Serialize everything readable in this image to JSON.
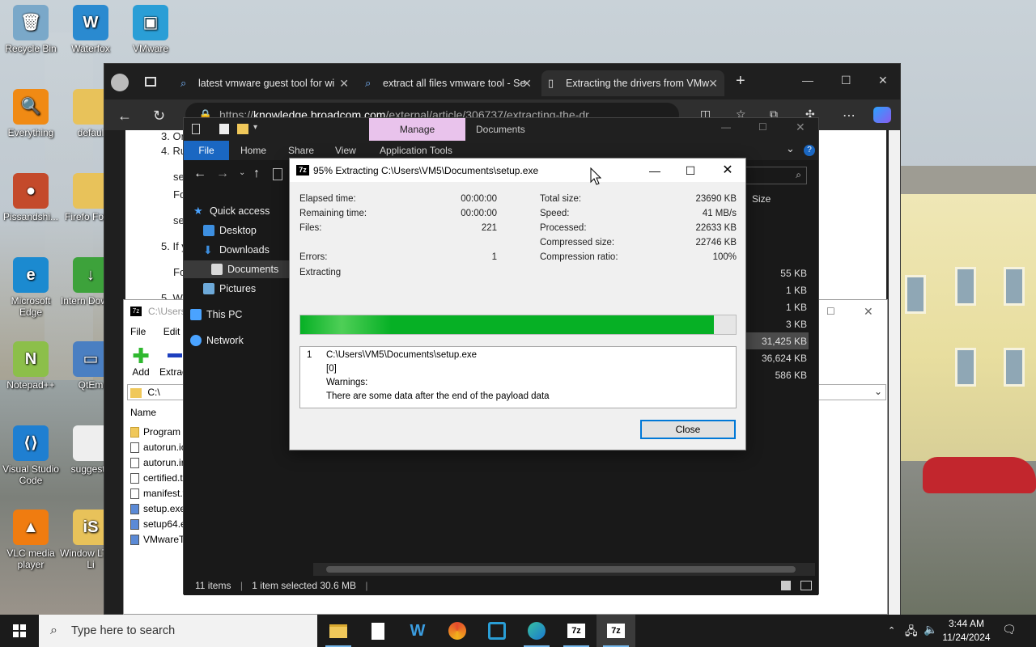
{
  "desktop": {
    "icons": [
      {
        "label": "Recycle Bin",
        "glyph": "🗑",
        "color": "#7aa8c9"
      },
      {
        "label": "Waterfox",
        "glyph": "W",
        "color": "#2a8ad0"
      },
      {
        "label": "VMware",
        "glyph": "▣",
        "color": "#2a9ed6"
      },
      {
        "label": "Everything",
        "glyph": "🔍",
        "color": "#f08a14"
      },
      {
        "label": "defaul",
        "glyph": "",
        "color": "#e8c25a"
      },
      {
        "label": "Pissandshi...",
        "glyph": "●",
        "color": "#c44a2b"
      },
      {
        "label": "Firefo Folde",
        "glyph": "",
        "color": "#e8c25a"
      },
      {
        "label": "Microsoft Edge",
        "glyph": "e",
        "color": "#1b8ad0"
      },
      {
        "label": "Intern Downlo",
        "glyph": "↓",
        "color": "#3da23b"
      },
      {
        "label": "Notepad++",
        "glyph": "N",
        "color": "#8cbf4a"
      },
      {
        "label": "QtEm",
        "glyph": "▭",
        "color": "#4a7fc2"
      },
      {
        "label": "Visual Studio Code",
        "glyph": "⟨⟩",
        "color": "#1f7fd1"
      },
      {
        "label": "suggeste",
        "glyph": "",
        "color": "#eeeeee"
      },
      {
        "label": "VLC media player",
        "glyph": "▲",
        "color": "#f07c10"
      },
      {
        "label": "Window LTSC Li",
        "glyph": "iS",
        "color": "#e8c25a"
      }
    ]
  },
  "browser": {
    "tabs": [
      {
        "label": "latest vmware guest tool for wi",
        "close": "✕"
      },
      {
        "label": "extract all files vmware tool - Se",
        "close": "✕"
      },
      {
        "label": "Extracting the drivers from VMw",
        "close": "✕"
      }
    ],
    "new_tab": "+",
    "url_prefix": "https://",
    "url_host": "knowledge.broadcom.com",
    "url_path": "/external/article/306737/extracting-the-dr...",
    "page_lines": [
      "3. Or",
      "4. Ru",
      "se",
      "Fo",
      "se",
      "5. If y",
      "Fo",
      "5. W"
    ]
  },
  "explorer": {
    "ribbon_tabs": [
      "File",
      "Home",
      "Share",
      "View",
      "Application Tools"
    ],
    "context_tab": "Manage",
    "title_tab": "Documents",
    "sidebar": [
      "Quick access",
      "Desktop",
      "Downloads",
      "Documents",
      "Pictures",
      "This PC",
      "Network"
    ],
    "size_header": "Size",
    "sizes": [
      "55 KB",
      "1 KB",
      "1 KB",
      "3 KB",
      "31,425 KB",
      "36,624 KB",
      "586 KB"
    ],
    "status_items": "11 items",
    "status_selected": "1 item selected  30.6 MB"
  },
  "sevenzip_fm": {
    "title": "C:\\Users",
    "menu": [
      "File",
      "Edit"
    ],
    "tools": [
      "Add",
      "Extrac"
    ],
    "path": "C:\\",
    "name_header": "Name",
    "files": [
      "Program I",
      "autorun.ic",
      "autorun.ir",
      "certified.t",
      "manifest.t",
      "setup.exe",
      "setup64.e",
      "VMwareTo"
    ]
  },
  "dialog": {
    "title": "95% Extracting C:\\Users\\VM5\\Documents\\setup.exe",
    "elapsed_label": "Elapsed time:",
    "elapsed": "00:00:00",
    "remaining_label": "Remaining time:",
    "remaining": "00:00:00",
    "files_label": "Files:",
    "files": "221",
    "errors_label": "Errors:",
    "errors": "1",
    "total_label": "Total size:",
    "total": "23690 KB",
    "speed_label": "Speed:",
    "speed": "41 MB/s",
    "processed_label": "Processed:",
    "processed": "22633 KB",
    "compressed_label": "Compressed size:",
    "compressed": "22746 KB",
    "ratio_label": "Compression ratio:",
    "ratio": "100%",
    "status": "Extracting",
    "progress_percent": 95,
    "messages": {
      "index": "1",
      "path": "C:\\Users\\VM5\\Documents\\setup.exe",
      "code": "[0]",
      "warn_label": "Warnings:",
      "warn_text": "There are some data after the end of the payload data"
    },
    "close_label": "Close"
  },
  "taskbar": {
    "search_placeholder": "Type here to search",
    "time": "3:44 AM",
    "date": "11/24/2024"
  }
}
